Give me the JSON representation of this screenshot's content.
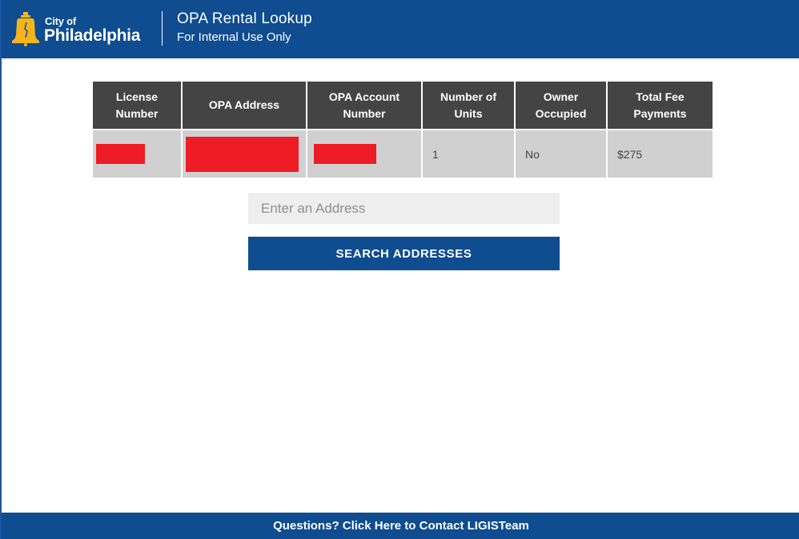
{
  "header": {
    "logo_city": "City of",
    "logo_name": "Philadelphia",
    "title": "OPA Rental Lookup",
    "subtitle": "For Internal Use Only",
    "bell_icon": "liberty-bell-icon",
    "brand_color": "#0f4c90",
    "logo_color": "#f5b41c"
  },
  "table": {
    "columns": [
      "License Number",
      "OPA Address",
      "OPA Account Number",
      "Number of Units",
      "Owner Occupied",
      "Total Fee Payments"
    ],
    "rows": [
      {
        "license_number": "[redacted]",
        "opa_address": "[redacted]",
        "opa_account_number": "[redacted]",
        "number_of_units": "1",
        "owner_occupied": "No",
        "total_fee_payments": "$275"
      }
    ],
    "redaction_color": "#ee1c25"
  },
  "search": {
    "placeholder": "Enter an Address",
    "value": "",
    "button_label": "SEARCH ADDRESSES"
  },
  "footer": {
    "link_text": "Questions? Click Here to Contact LIGISTeam"
  }
}
